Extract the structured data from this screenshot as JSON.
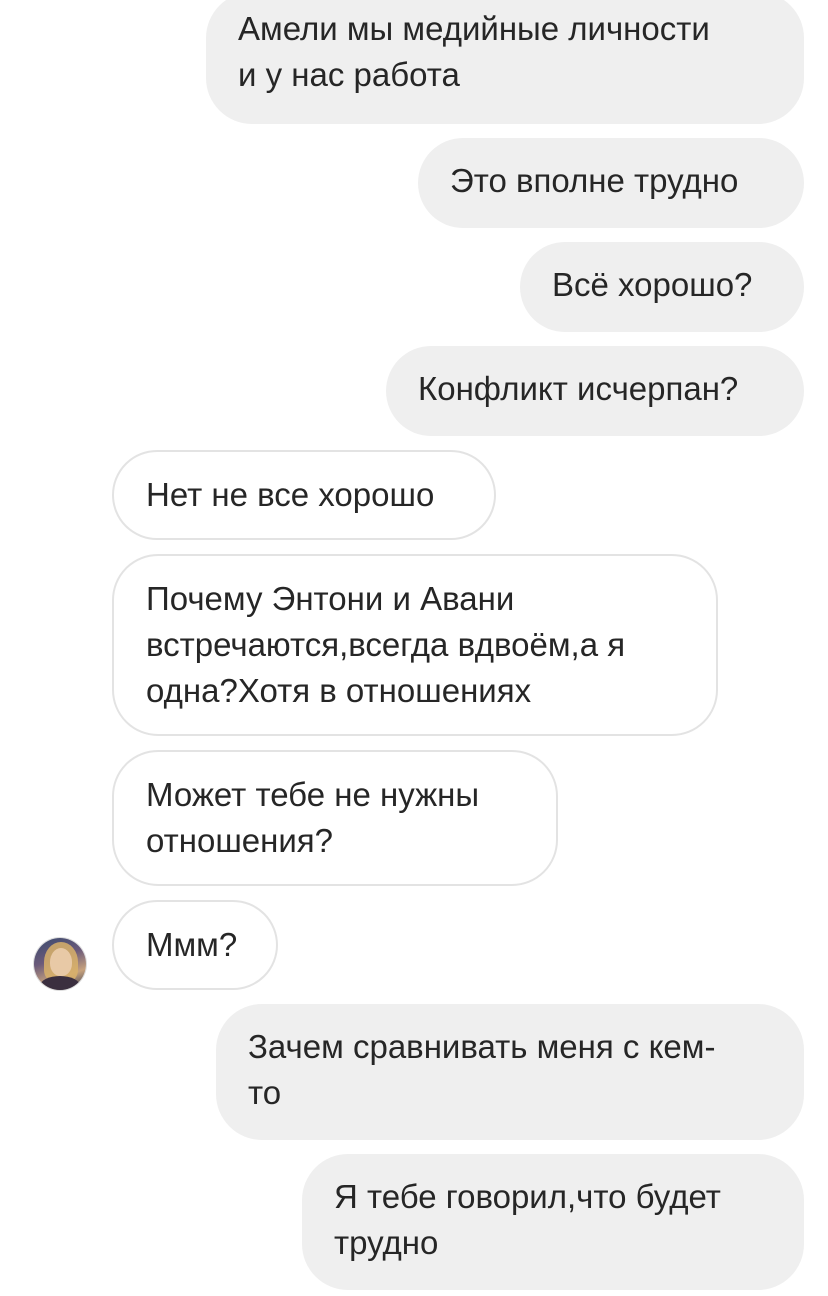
{
  "messages": [
    {
      "id": "m1",
      "side": "sent",
      "text": "Амели мы медийные личности\nи у нас работа"
    },
    {
      "id": "m2",
      "side": "sent",
      "text": "Это вполне трудно"
    },
    {
      "id": "m3",
      "side": "sent",
      "text": "Всё хорошо?"
    },
    {
      "id": "m4",
      "side": "sent",
      "text": "Конфликт исчерпан?"
    },
    {
      "id": "m5",
      "side": "received",
      "text": "Нет не все хорошо"
    },
    {
      "id": "m6",
      "side": "received",
      "text": "Почему Энтони и Авани\nвстречаются,всегда вдвоём,а я\nодна?Хотя в отношениях"
    },
    {
      "id": "m7",
      "side": "received",
      "text": "Может тебе не нужны\nотношения?"
    },
    {
      "id": "m8",
      "side": "received",
      "text": "Ммм?"
    },
    {
      "id": "m9",
      "side": "sent",
      "text": "Зачем сравнивать меня с кем-\nто"
    },
    {
      "id": "m10",
      "side": "sent",
      "text": "Я тебе говорил,что будет\nтрудно"
    }
  ],
  "avatar": {
    "icon": "profile-photo"
  }
}
